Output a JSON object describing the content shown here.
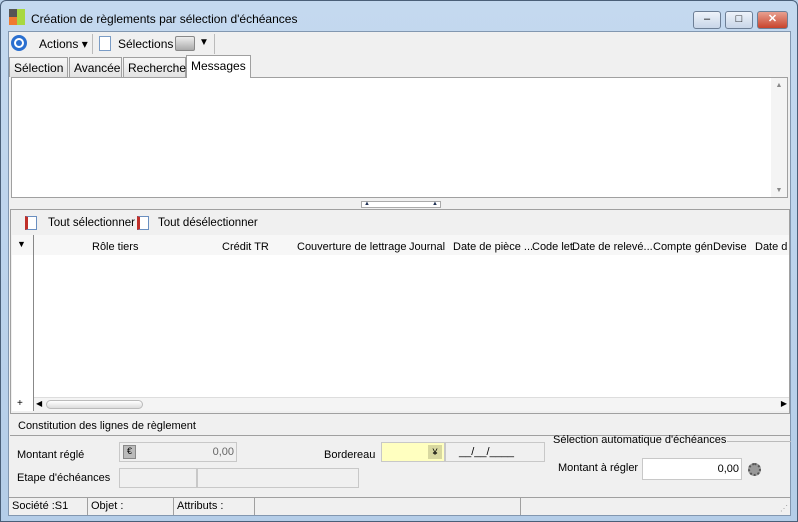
{
  "window": {
    "title": "Création de règlements par sélection d'échéances",
    "minimize": "–",
    "maximize": "□",
    "close": "✕"
  },
  "toolbar": {
    "actions": "Actions",
    "selections": "Sélections"
  },
  "tabs": [
    "Sélection",
    "Avancée",
    "Recherche",
    "Messages"
  ],
  "grid_toolbar": {
    "select_all": "Tout sélectionner",
    "deselect_all": "Tout désélectionner"
  },
  "columns": [
    "Rôle tiers",
    "Crédit TR",
    "Couverture de lettrage",
    "Journal",
    "Date de pièce ...",
    "Code let",
    "Date de relevé...",
    "Compte gén",
    "Devise",
    "Date d"
  ],
  "section_label": "Constitution des lignes de règlement",
  "form": {
    "montant_regle_label": "Montant réglé",
    "montant_regle_value": "0,00",
    "etape_label": "Etape d'échéances",
    "bordereau_label": "Bordereau",
    "bordereau_date": "__/__/____",
    "auto_group": "Sélection automatique d'échéances",
    "montant_a_regler_label": "Montant à régler",
    "montant_a_regler_value": "0,00"
  },
  "status": {
    "societe": "Société :S1",
    "objet": "Objet :",
    "attributs": "Attributs :"
  },
  "colors": {
    "accent": "#ffffc0",
    "selection": "#d7e4f2"
  }
}
